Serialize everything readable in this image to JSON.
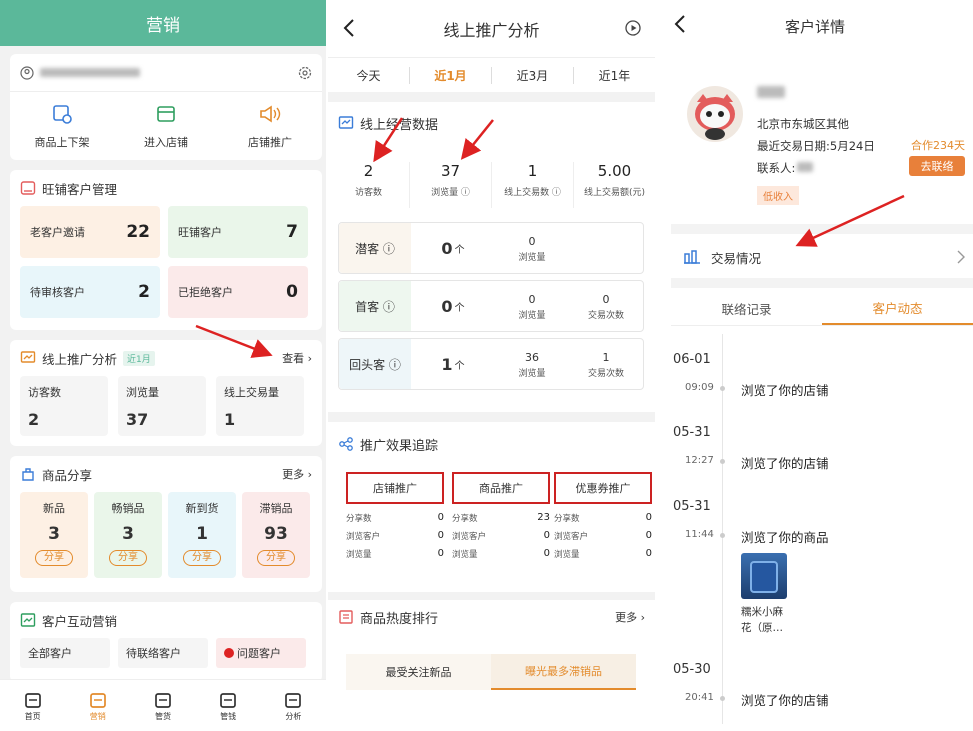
{
  "p1": {
    "title": "营销",
    "quick": [
      "商品上下架",
      "进入店铺",
      "店铺推广"
    ],
    "crm": {
      "title": "旺铺客户管理",
      "cells": [
        {
          "label": "老客户邀请",
          "value": "22",
          "bg": "#fdf0e4"
        },
        {
          "label": "旺铺客户",
          "value": "7",
          "bg": "#eaf6ea"
        },
        {
          "label": "待审核客户",
          "value": "2",
          "bg": "#e8f6fa"
        },
        {
          "label": "已拒绝客户",
          "value": "0",
          "bg": "#fbeaea"
        }
      ]
    },
    "analysis": {
      "title": "线上推广分析",
      "tag": "近1月",
      "more": "查看",
      "stats": [
        {
          "label": "访客数",
          "value": "2"
        },
        {
          "label": "浏览量",
          "value": "37"
        },
        {
          "label": "线上交易量",
          "value": "1"
        }
      ]
    },
    "share": {
      "title": "商品分享",
      "more": "更多",
      "items": [
        {
          "label": "新品",
          "value": "3",
          "btn": "分享",
          "bg": "#fdf0e4",
          "color": "#e38b2c"
        },
        {
          "label": "畅销品",
          "value": "3",
          "btn": "分享",
          "bg": "#eaf6ea",
          "color": "#e38b2c"
        },
        {
          "label": "新到货",
          "value": "1",
          "btn": "分享",
          "bg": "#e8f6fa",
          "color": "#e38b2c"
        },
        {
          "label": "滞销品",
          "value": "93",
          "btn": "分享",
          "bg": "#fbeaea",
          "color": "#e38b2c"
        }
      ]
    },
    "interact": {
      "title": "客户互动营销",
      "cells": [
        "全部客户",
        "待联络客户",
        "问题客户"
      ]
    },
    "tabbar": [
      "首页",
      "营销",
      "管货",
      "管钱",
      "分析"
    ]
  },
  "p2": {
    "title": "线上推广分析",
    "tabs": [
      "今天",
      "近1月",
      "近3月",
      "近1年"
    ],
    "section1": "线上经营数据",
    "stats": [
      {
        "value": "2",
        "label": "访客数"
      },
      {
        "value": "37",
        "label": "浏览量 ⓘ"
      },
      {
        "value": "1",
        "label": "线上交易数 ⓘ"
      },
      {
        "value": "5.00",
        "label": "线上交易额(元)"
      }
    ],
    "rows": [
      {
        "label": "潜客 ⓘ",
        "big": "0",
        "unit": "个",
        "cols": [
          {
            "v": "0",
            "l": "浏览量"
          }
        ],
        "bg": "#faf5ee"
      },
      {
        "label": "首客 ⓘ",
        "big": "0",
        "unit": "个",
        "cols": [
          {
            "v": "0",
            "l": "浏览量"
          },
          {
            "v": "0",
            "l": "交易次数"
          }
        ],
        "bg": "#eef7ef"
      },
      {
        "label": "回头客 ⓘ",
        "big": "1",
        "unit": "个",
        "cols": [
          {
            "v": "36",
            "l": "浏览量"
          },
          {
            "v": "1",
            "l": "交易次数"
          }
        ],
        "bg": "#eef6f9"
      }
    ],
    "section2": "推广效果追踪",
    "promos": [
      {
        "title": "店铺推广",
        "rows": [
          {
            "l": "分享数",
            "v": "0"
          },
          {
            "l": "浏览客户",
            "v": "0"
          },
          {
            "l": "浏览量",
            "v": "0"
          }
        ]
      },
      {
        "title": "商品推广",
        "rows": [
          {
            "l": "分享数",
            "v": "23"
          },
          {
            "l": "浏览客户",
            "v": "0"
          },
          {
            "l": "浏览量",
            "v": "0"
          }
        ]
      },
      {
        "title": "优惠券推广",
        "rows": [
          {
            "l": "分享数",
            "v": "0"
          },
          {
            "l": "浏览客户",
            "v": "0"
          },
          {
            "l": "浏览量",
            "v": "0"
          }
        ]
      }
    ],
    "section3": "商品热度排行",
    "more": "更多",
    "rankTabs": [
      "最受关注新品",
      "曝光最多滞销品"
    ]
  },
  "p3": {
    "title": "客户详情",
    "address": "北京市东城区其他",
    "lastTrade": "最近交易日期:5月24日",
    "contact": "联系人:",
    "coop": "合作234天",
    "btn": "去联络",
    "badge": "低收入",
    "trade": "交易情况",
    "tabs": [
      "联络记录",
      "客户动态"
    ],
    "timeline": [
      {
        "date": "06-01",
        "time": "09:09",
        "text": "浏览了你的店铺"
      },
      {
        "date": "05-31",
        "time": "12:27",
        "text": "浏览了你的店铺"
      },
      {
        "date": "05-31",
        "time": "11:44",
        "text": "浏览了你的商品"
      },
      {
        "date": "05-30",
        "time": "20:41",
        "text": "浏览了你的店铺"
      }
    ],
    "product": "糯米小麻\n花（原…"
  }
}
